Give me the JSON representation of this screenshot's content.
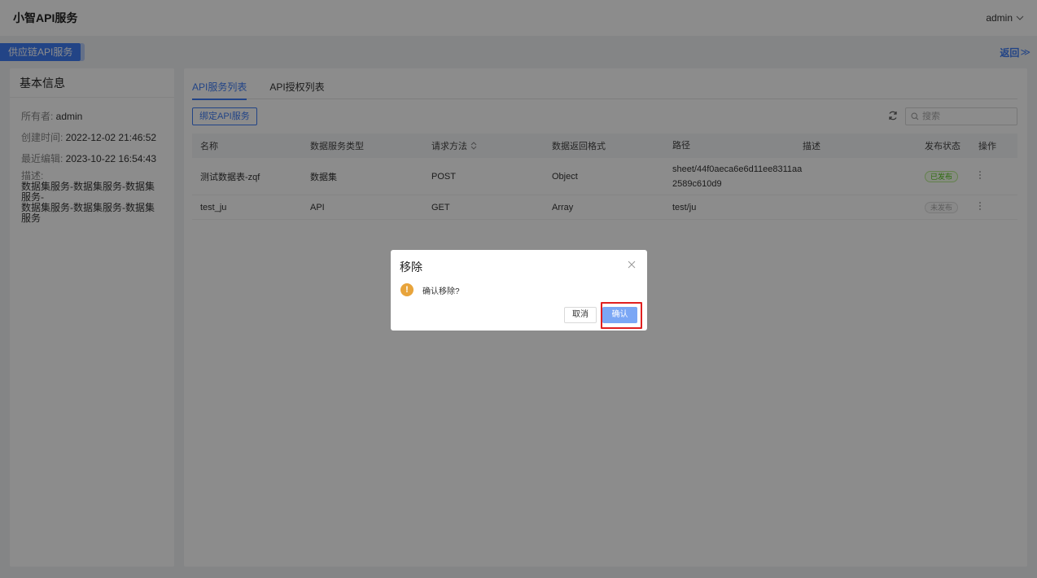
{
  "header": {
    "title": "小智API服务",
    "user": "admin"
  },
  "subbar": {
    "tag": "供应链API服务",
    "back": "返回",
    "back_chevron": "≫"
  },
  "info": {
    "title": "基本信息",
    "owner_label": "所有者: ",
    "owner": "admin",
    "created_label": "创建时间: ",
    "created": "2022-12-02 21:46:52",
    "edited_label": "最近编辑: ",
    "edited": "2023-10-22 16:54:43",
    "desc_label": "描述:",
    "desc_line1": "数据集服务-数据集服务-数据集服务-",
    "desc_line2": "数据集服务-数据集服务-数据集服务"
  },
  "tabs": [
    {
      "label": "API服务列表",
      "active": true
    },
    {
      "label": "API授权列表",
      "active": false
    }
  ],
  "toolbar": {
    "bind_button": "绑定API服务",
    "search_placeholder": "搜索"
  },
  "table": {
    "headers": {
      "name": "名称",
      "type": "数据服务类型",
      "method": "请求方法",
      "format": "数据返回格式",
      "path": "路径",
      "desc": "描述",
      "status": "发布状态",
      "op": "操作"
    },
    "rows": [
      {
        "name": "测试数据表-zqf",
        "type": "数据集",
        "method": "POST",
        "format": "Object",
        "path_l1": "sheet/44f0aeca6e6d11ee8311aa",
        "path_l2": "2589c610d9",
        "desc": "",
        "status": "已发布"
      },
      {
        "name": "test_ju",
        "type": "API",
        "method": "GET",
        "format": "Array",
        "path_l1": "test/ju",
        "path_l2": "",
        "desc": "",
        "status": "未发布"
      }
    ]
  },
  "dialog": {
    "title": "移除",
    "message": "确认移除?",
    "cancel": "取消",
    "confirm": "确认",
    "warn_glyph": "!"
  },
  "colors": {
    "primary": "#3f7cf4",
    "warning": "#e8a43b",
    "highlight": "#e02020",
    "published": "#52c41a"
  }
}
